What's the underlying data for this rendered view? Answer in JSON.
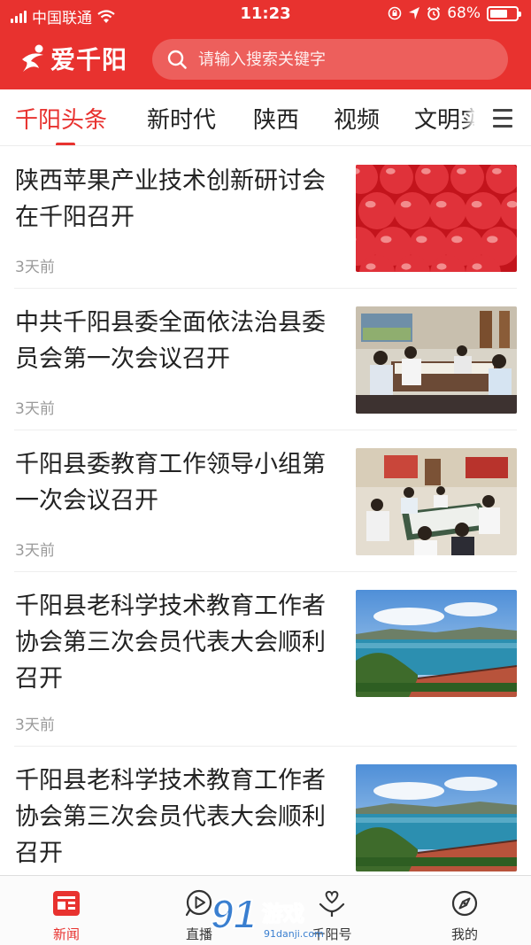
{
  "status_bar": {
    "carrier": "中国联通",
    "time": "11:23",
    "battery": "68%",
    "battery_level": 0.68
  },
  "header": {
    "app_name": "爱千阳",
    "search_placeholder": "请输入搜索关键字",
    "brand_color": "#e8322f"
  },
  "tabs": [
    {
      "label": "千阳头条",
      "active": true
    },
    {
      "label": "新时代",
      "active": false
    },
    {
      "label": "陕西",
      "active": false
    },
    {
      "label": "视频",
      "active": false
    },
    {
      "label": "文明实",
      "active": false
    }
  ],
  "news": [
    {
      "title": "陕西苹果产业技术创新研讨会在千阳召开",
      "time": "3天前",
      "image": "apples"
    },
    {
      "title": "中共千阳县委全面依法治县委员会第一次会议召开",
      "time": "3天前",
      "image": "meeting"
    },
    {
      "title": "千阳县委教育工作领导小组第一次会议召开",
      "time": "3天前",
      "image": "meeting-room"
    },
    {
      "title": "千阳县老科学技术教育工作者协会第三次会员代表大会顺利召开",
      "time": "3天前",
      "image": "lake-landscape"
    },
    {
      "title": "千阳县老科学技术教育工作者协会第三次会员代表大会顺利召开",
      "time": "",
      "image": "lake-landscape"
    }
  ],
  "bottom_nav": [
    {
      "label": "新闻",
      "icon": "news-icon",
      "active": true
    },
    {
      "label": "直播",
      "icon": "play-icon",
      "active": false
    },
    {
      "label": "千阳号",
      "icon": "heart-hand-icon",
      "active": false
    },
    {
      "label": "我的",
      "icon": "compass-icon",
      "active": false
    }
  ],
  "watermark": {
    "text": "游戏",
    "number": "91",
    "site": "91danji.com"
  }
}
